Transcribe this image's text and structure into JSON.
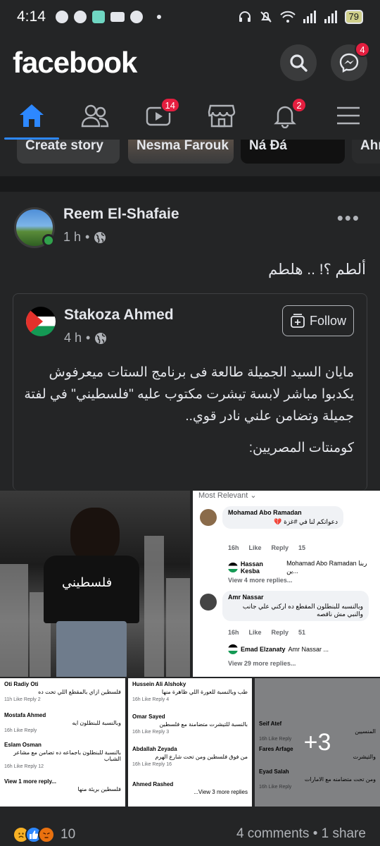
{
  "status_bar": {
    "time": "4:14",
    "battery": "79"
  },
  "header": {
    "logo": "facebook",
    "messenger_badge": "4"
  },
  "tabs": {
    "watch_badge": "14",
    "notifications_badge": "2"
  },
  "stories": [
    {
      "label": "Create story"
    },
    {
      "label": "Nesma Farouk"
    },
    {
      "label": "Ñá Đá"
    },
    {
      "label": "Ahr"
    }
  ],
  "post": {
    "author": "Reem El-Shafaie",
    "time": "1 h",
    "dot": "•",
    "more": "•••",
    "text": "ألطم ؟! .. هلطم",
    "shared": {
      "author": "Stakoza Ahmed",
      "time": "4 h",
      "follow_label": "Follow",
      "text_p1": "مايان السيد الجميلة طالعة فى برنامج الستات ميعرفوش يكدبوا مباشر لابسة تيشرت مكتوب عليه \"فلسطيني\" في لفتة جميلة وتضامن علني نادر قوي..",
      "text_p2": "كومنتات المصريين:"
    },
    "photo_main_shirt_text": "فلسطيني",
    "photo_comments": {
      "header": "Most Relevant ⌄",
      "c1": {
        "name": "Mohamad Abo Ramadan",
        "text": "دعواتكم لنا في #غزة 💔",
        "time": "16h",
        "like": "Like",
        "reply": "Reply",
        "count": "15",
        "reply_name": "Hassan Kesba",
        "reply_text": "Mohamad Abo Ramadan ربنا ين...",
        "more": "View 4 more replies..."
      },
      "c2": {
        "name": "Amr Nassar",
        "text": "وبالنسبه للبنطلون المقطع ده اركني علي جانب والنبي مش ناقصه",
        "time": "16h",
        "like": "Like",
        "reply": "Reply",
        "count": "51",
        "reply_name": "Emad Elzanaty",
        "reply_text": "Amr Nassar ...",
        "more": "View 29 more replies..."
      }
    },
    "mini_1": [
      {
        "name": "Oti Radiy Oti",
        "text": "فلسطين ازاي بالمقطع اللي تحت ده",
        "meta": "11h Like Reply 2"
      },
      {
        "name": "Mostafa Ahmed",
        "text": "وبالنسبة للبنطلون ايه",
        "meta": "16h Like Reply"
      },
      {
        "name": "Eslam Osman",
        "text": "بالنسبة للبنطلون باجماعه ده تضامن مع مشاعر الشباب",
        "meta": "16h Like Reply 12"
      },
      {
        "name": "View 1 more reply...",
        "text": "فلسطين بريئة منها",
        "meta": ""
      }
    ],
    "mini_2": [
      {
        "name": "Hussein Ali Alshoky",
        "text": "طب وبالنسبة للعورة اللي ظاهرة منها",
        "meta": "16h Like Reply 4"
      },
      {
        "name": "Omar Sayed",
        "text": "بالنسبة للتيشرت متضامنة مع فلسطين",
        "meta": "16h Like Reply 3"
      },
      {
        "name": "Abdallah Zeyada",
        "text": "من فوق فلسطين ومن تحت شارع الهرم",
        "meta": "16h Like Reply 16"
      },
      {
        "name": "Ahmed Rashed",
        "text": "View 3 more replies...",
        "meta": ""
      }
    ],
    "mini_3": [
      {
        "name": "Seif Atef",
        "text": "المنسيين",
        "meta": "16h Like Reply"
      },
      {
        "name": "Fares Arfage",
        "text": "والتيشرت",
        "meta": ""
      },
      {
        "name": "Eyad Salah",
        "text": "ومن تحت متضامنه مع الامارات",
        "meta": "16h Like Reply"
      }
    ],
    "more_photos": "+3",
    "reactions_count": "10",
    "comments_shares": "4 comments • 1 share"
  }
}
